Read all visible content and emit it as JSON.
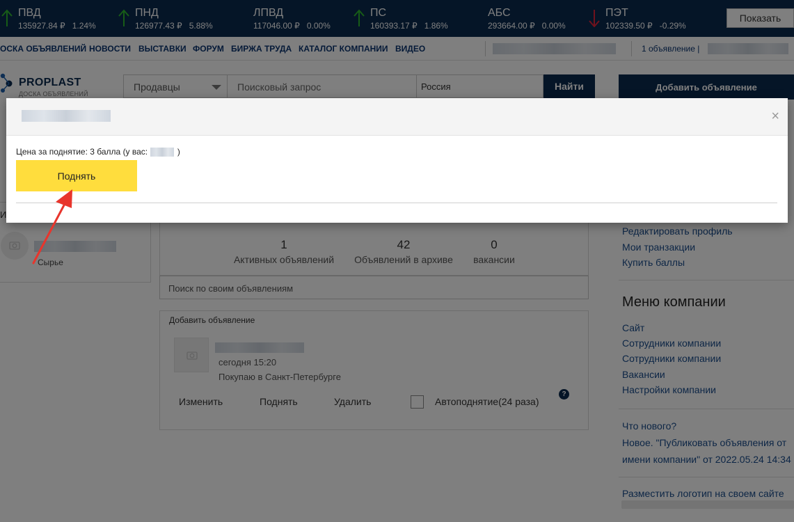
{
  "ticker": {
    "items": [
      {
        "name": "ПВД",
        "price": "135927.84 ₽",
        "change": "1.24%",
        "dir": "up"
      },
      {
        "name": "ПНД",
        "price": "126977.43 ₽",
        "change": "5.88%",
        "dir": "up"
      },
      {
        "name": "ЛПВД",
        "price": "117046.00 ₽",
        "change": "0.00%",
        "dir": "none"
      },
      {
        "name": "ПС",
        "price": "160393.17 ₽",
        "change": "1.86%",
        "dir": "up"
      },
      {
        "name": "АБС",
        "price": "293664.00 ₽",
        "change": "0.00%",
        "dir": "none"
      },
      {
        "name": "ПЭТ",
        "price": "102339.50 ₽",
        "change": "-0.29%",
        "dir": "down"
      }
    ],
    "show_label": "Показать"
  },
  "nav": {
    "items": [
      "ОСКА ОБЪЯВЛЕНИЙ",
      "НОВОСТИ",
      "ВЫСТАВКИ",
      "ФОРУМ",
      "БИРЖА ТРУДА",
      "КАТАЛОГ КОМПАНИИ",
      "ВИДЕО"
    ],
    "ads_count": "1 объявление |"
  },
  "header": {
    "logo_title": "PROPLAST",
    "logo_sub": "ДОСКА ОБЪЯВЛЕНИЙ",
    "sellers_select": "Продавцы",
    "search_placeholder": "Поисковый запрос",
    "region": "Россия",
    "find_label": "Найти",
    "add_ad_label": "Добавить объявление"
  },
  "left": {
    "letter": "И",
    "category": "Сырье"
  },
  "stats": [
    {
      "n": "1",
      "label": "Активных объявлений"
    },
    {
      "n": "42",
      "label": "Объявлений в архиве"
    },
    {
      "n": "0",
      "label": "вакансии"
    }
  ],
  "own_search_placeholder": "Поиск по своим объявлениям",
  "ad": {
    "header": "Добавить объявление",
    "date": "сегодня 15:20",
    "location": "Покупаю в Санкт-Петербурге",
    "actions": {
      "edit": "Изменить",
      "raise": "Поднять",
      "delete": "Удалить"
    },
    "auto_raise": "Автоподнятие(24 раза)",
    "help": "?"
  },
  "right": {
    "profile_links": [
      "Редактировать профиль",
      "Мои транзакции",
      "Купить баллы"
    ],
    "company_menu_title": "Меню компании",
    "company_links": [
      "Сайт",
      "Сотрудники компании",
      "Сотрудники компании",
      "Вакансии",
      "Настройки компании"
    ],
    "whats_new": "Что нового?",
    "news_text": "Новое. \"Публиковать объявления от имени компании\" от 2022.05.24 14:34",
    "logo_link": "Разместить логотип на своем сайте"
  },
  "modal": {
    "close": "×",
    "price_prefix": "Цена за поднятие: 3 балла (у вас:",
    "price_suffix": ")",
    "raise_button": "Поднять"
  },
  "colors": {
    "navy": "#0b2a4f",
    "up": "#2eb82e",
    "down": "#e0243a",
    "raise_button": "#ffdd3d",
    "annotation_arrow": "#e8352c"
  }
}
